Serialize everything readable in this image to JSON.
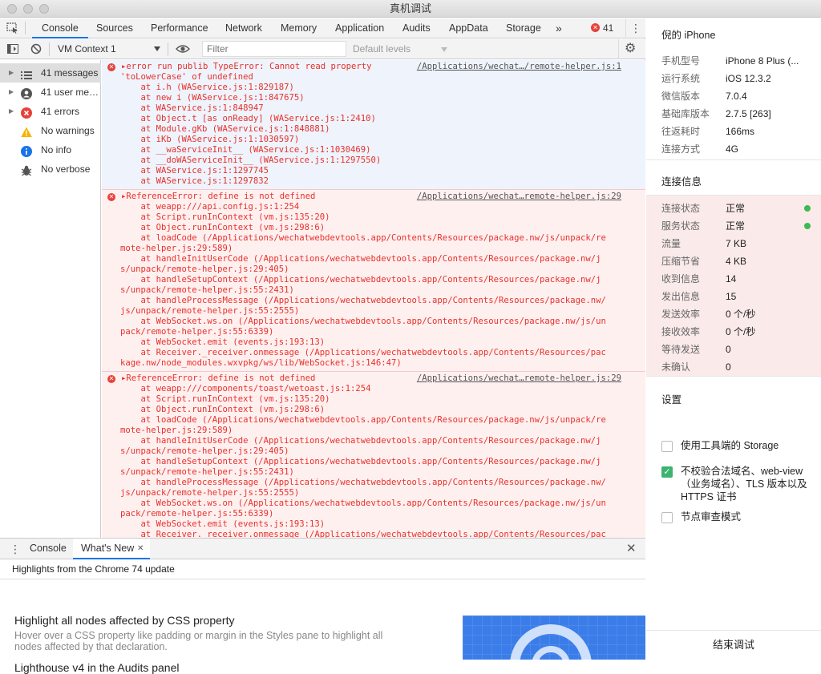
{
  "window": {
    "title": "真机调试"
  },
  "tabs": [
    "Console",
    "Sources",
    "Performance",
    "Network",
    "Memory",
    "Application",
    "Audits",
    "AppData",
    "Storage"
  ],
  "tabs_more": "»",
  "error_badge": "41",
  "toolbar": {
    "context": "VM Context 1",
    "filter_placeholder": "Filter",
    "levels": "Default levels"
  },
  "sidebar": [
    {
      "label": "41 messages",
      "icon": "list-icon"
    },
    {
      "label": "41 user me…",
      "icon": "user-icon"
    },
    {
      "label": "41 errors",
      "icon": "error-icon"
    },
    {
      "label": "No warnings",
      "icon": "warning-icon"
    },
    {
      "label": "No info",
      "icon": "info-icon"
    },
    {
      "label": "No verbose",
      "icon": "bug-icon"
    }
  ],
  "messages": [
    {
      "source": "/Applications/wechat…/remote-helper.js:1",
      "lines": [
        "▸error run publib TypeError: Cannot read property",
        "'toLowerCase' of undefined",
        "    at i.h (WAService.js:1:829187)",
        "    at new i (WAService.js:1:847675)",
        "    at WAService.js:1:848947",
        "    at Object.t [as onReady] (WAService.js:1:2410)",
        "    at Module.gKb (WAService.js:1:848881)",
        "    at iKb (WAService.js:1:1030597)",
        "    at __waServiceInit__ (WAService.js:1:1030469)",
        "    at __doWAServiceInit__ (WAService.js:1:1297550)",
        "    at WAService.js:1:1297745",
        "    at WAService.js:1:1297832"
      ]
    },
    {
      "source": "/Applications/wechat…remote-helper.js:29",
      "lines": [
        "▸ReferenceError: define is not defined",
        "    at weapp:///api.config.js:1:254",
        "    at Script.runInContext (vm.js:135:20)",
        "    at Object.runInContext (vm.js:298:6)",
        "    at loadCode (/Applications/wechatwebdevtools.app/Contents/Resources/package.nw/js/unpack/re",
        "mote-helper.js:29:589)",
        "    at handleInitUserCode (/Applications/wechatwebdevtools.app/Contents/Resources/package.nw/j",
        "s/unpack/remote-helper.js:29:405)",
        "    at handleSetupContext (/Applications/wechatwebdevtools.app/Contents/Resources/package.nw/j",
        "s/unpack/remote-helper.js:55:2431)",
        "    at handleProcessMessage (/Applications/wechatwebdevtools.app/Contents/Resources/package.nw/",
        "js/unpack/remote-helper.js:55:2555)",
        "    at WebSocket.ws.on (/Applications/wechatwebdevtools.app/Contents/Resources/package.nw/js/un",
        "pack/remote-helper.js:55:6339)",
        "    at WebSocket.emit (events.js:193:13)",
        "    at Receiver._receiver.onmessage (/Applications/wechatwebdevtools.app/Contents/Resources/pac",
        "kage.nw/node_modules.wxvpkg/ws/lib/WebSocket.js:146:47)"
      ]
    },
    {
      "source": "/Applications/wechat…remote-helper.js:29",
      "lines": [
        "▸ReferenceError: define is not defined",
        "    at weapp:///components/toast/wetoast.js:1:254",
        "    at Script.runInContext (vm.js:135:20)",
        "    at Object.runInContext (vm.js:298:6)",
        "    at loadCode (/Applications/wechatwebdevtools.app/Contents/Resources/package.nw/js/unpack/re",
        "mote-helper.js:29:589)",
        "    at handleInitUserCode (/Applications/wechatwebdevtools.app/Contents/Resources/package.nw/j",
        "s/unpack/remote-helper.js:29:405)",
        "    at handleSetupContext (/Applications/wechatwebdevtools.app/Contents/Resources/package.nw/j",
        "s/unpack/remote-helper.js:55:2431)",
        "    at handleProcessMessage (/Applications/wechatwebdevtools.app/Contents/Resources/package.nw/",
        "js/unpack/remote-helper.js:55:2555)",
        "    at WebSocket.ws.on (/Applications/wechatwebdevtools.app/Contents/Resources/package.nw/js/un",
        "pack/remote-helper.js:55:6339)",
        "    at WebSocket.emit (events.js:193:13)",
        "    at Receiver._receiver.onmessage (/Applications/wechatwebdevtools.app/Contents/Resources/pac"
      ]
    }
  ],
  "drawer": {
    "tab_console": "Console",
    "tab_whatsnew": "What's New",
    "close_tab": "✕",
    "subtitle": "Highlights from the Chrome 74 update",
    "item1_title": "Highlight all nodes affected by CSS property",
    "item1_desc": "Hover over a CSS property like padding or margin in the Styles pane to highlight all nodes affected by that declaration.",
    "item2_title": "Lighthouse v4 in the Audits panel"
  },
  "device": {
    "title": "倪的 iPhone",
    "rows": [
      {
        "k": "手机型号",
        "v": "iPhone 8 Plus (..."
      },
      {
        "k": "运行系统",
        "v": "iOS 12.3.2"
      },
      {
        "k": "微信版本",
        "v": "7.0.4"
      },
      {
        "k": "基础库版本",
        "v": "2.7.5 [263]"
      },
      {
        "k": "往返耗时",
        "v": "166ms"
      },
      {
        "k": "连接方式",
        "v": "4G"
      }
    ]
  },
  "connection": {
    "title": "连接信息",
    "rows": [
      {
        "k": "连接状态",
        "v": "正常",
        "dot": true
      },
      {
        "k": "服务状态",
        "v": "正常",
        "dot": true
      },
      {
        "k": "流量",
        "v": "7 KB"
      },
      {
        "k": "压缩节省",
        "v": "4 KB"
      },
      {
        "k": "收到信息",
        "v": "14"
      },
      {
        "k": "发出信息",
        "v": "15"
      },
      {
        "k": "发送效率",
        "v": "0 个/秒"
      },
      {
        "k": "接收效率",
        "v": "0 个/秒"
      },
      {
        "k": "等待发送",
        "v": "0"
      },
      {
        "k": "未确认",
        "v": "0"
      }
    ]
  },
  "settings": {
    "title": "设置",
    "options": [
      {
        "label": "使用工具端的 Storage",
        "checked": false
      },
      {
        "label": "不校验合法域名、web-view（业务域名）、TLS 版本以及 HTTPS 证书",
        "checked": true
      },
      {
        "label": "节点审查模式",
        "checked": false
      }
    ]
  },
  "stop_button": "结束调试",
  "colors": {
    "accent": "#1a73e8",
    "error": "#e8312a",
    "ok": "#3fb950",
    "check": "#3cb371"
  }
}
